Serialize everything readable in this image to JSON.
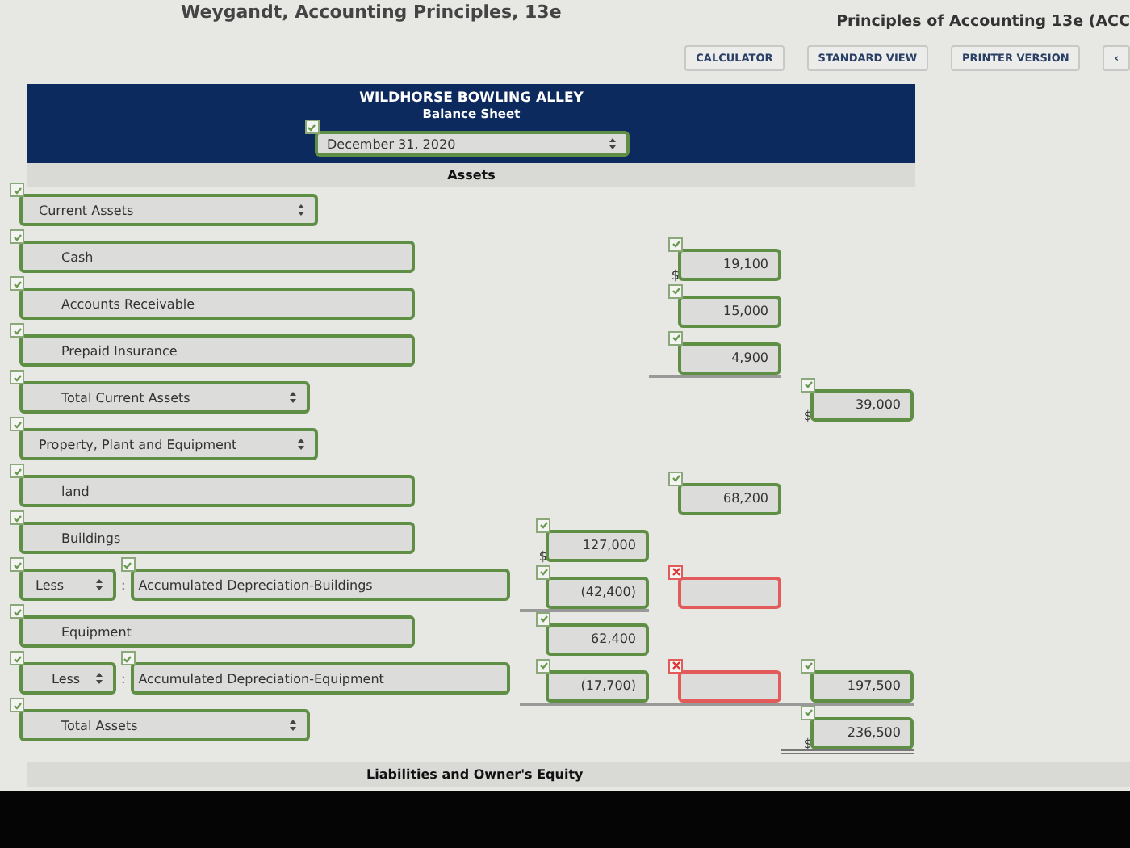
{
  "book_title": "Weygandt, Accounting Principles, 13e",
  "course_title": "Principles of Accounting 13e (ACC",
  "toolbar": [
    "CALCULATOR",
    "STANDARD VIEW",
    "PRINTER VERSION",
    "‹"
  ],
  "header": {
    "company": "WILDHORSE BOWLING ALLEY",
    "statement": "Balance Sheet",
    "date": {
      "value": "December 31, 2020",
      "correct": true
    }
  },
  "section": "Assets",
  "rows": [
    {
      "kind": "select",
      "label": "Current Assets",
      "indent": false,
      "correct": true
    },
    {
      "kind": "field",
      "label": "Cash",
      "correct": true,
      "column_2": {
        "value": "19,100",
        "prefix": "$",
        "correct": true,
        "underlined": false
      }
    },
    {
      "kind": "field",
      "label": "Accounts Receivable",
      "correct": true,
      "column_2": {
        "value": "15,000",
        "correct": true,
        "underlined": false
      }
    },
    {
      "kind": "field",
      "label": "Prepaid Insurance",
      "correct": true,
      "column_2": {
        "value": "4,900",
        "correct": true,
        "underlined": true
      }
    },
    {
      "kind": "select",
      "label": "Total Current Assets",
      "indent": true,
      "correct": true,
      "column_3": {
        "value": "39,000",
        "prefix": "$",
        "correct": true,
        "underlined": false
      }
    },
    {
      "kind": "select",
      "label": "Property, Plant and Equipment",
      "indent": false,
      "correct": true
    },
    {
      "kind": "field",
      "label": "land",
      "correct": true,
      "column_2": {
        "value": "68,200",
        "correct": true,
        "underlined": false
      }
    },
    {
      "kind": "field",
      "label": "Buildings",
      "correct": true,
      "column_1": {
        "value": "127,000",
        "prefix": "$",
        "correct": true,
        "underlined": false
      }
    },
    {
      "kind": "less",
      "operator": "Less",
      "separator": ":",
      "label": "Accumulated Depreciation-Buildings",
      "correct": true,
      "column_1": {
        "value": "(42,400)",
        "correct": true,
        "underlined": true
      },
      "column_2": {
        "correct": false,
        "underlined": false
      }
    },
    {
      "kind": "field",
      "label": "Equipment",
      "correct": true,
      "column_1": {
        "value": "62,400",
        "correct": true,
        "underlined": false
      }
    },
    {
      "kind": "less",
      "operator": "Less",
      "separator": ":",
      "label": "Accumulated Depreciation-Equipment",
      "correct": true,
      "column_1": {
        "value": "(17,700)",
        "correct": true,
        "underlined": true
      },
      "column_2": {
        "correct": false,
        "underlined": true
      },
      "column_3": {
        "value": "197,500",
        "correct": true,
        "underlined": true
      }
    },
    {
      "kind": "select",
      "label": "Total Assets",
      "indent": true,
      "correct": true,
      "column_3": {
        "value": "236,500",
        "prefix": "$",
        "correct": true,
        "underlined": true,
        "double_underlined": true
      }
    }
  ],
  "section_2": "Liabilities and Owner's Equity"
}
